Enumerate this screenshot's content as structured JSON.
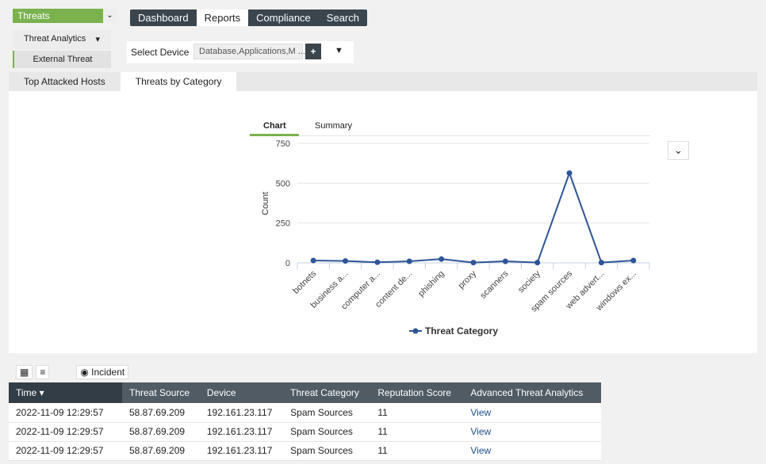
{
  "module": {
    "selected": "Threats"
  },
  "nav": [
    "Dashboard",
    "Reports",
    "Compliance",
    "Search"
  ],
  "sidebar": {
    "group": "Threat Analytics",
    "item": "External Threat"
  },
  "device_filter": {
    "label": "Select Device",
    "value": "Database,Applications,M ...",
    "add": "+"
  },
  "report_tabs": [
    "Top Attacked Hosts",
    "Threats by Category"
  ],
  "chart_tabs": [
    "Chart",
    "Summary"
  ],
  "chart_data": {
    "type": "line",
    "categories": [
      "botnets",
      "business a...",
      "computer a...",
      "content de...",
      "phishing",
      "proxy",
      "scanners",
      "society",
      "spam sources",
      "web advert...",
      "windows ex..."
    ],
    "series": [
      {
        "name": "Threat Category",
        "values": [
          15,
          12,
          4,
          10,
          24,
          2,
          10,
          2,
          563,
          2,
          15
        ]
      }
    ],
    "ylabel": "Count",
    "ylim": [
      0,
      750
    ],
    "yticks": [
      0,
      250,
      500,
      750
    ],
    "grid": true,
    "legend": "bottom",
    "color": "#2f5597"
  },
  "toolbar": {
    "incident": "Incident"
  },
  "table": {
    "columns": [
      "Time",
      "Threat Source",
      "Device",
      "Threat Category",
      "Reputation Score",
      "Advanced Threat Analytics"
    ],
    "rows": [
      [
        "2022-11-09 12:29:57",
        "58.87.69.209",
        "192.161.23.117",
        "Spam Sources",
        "11",
        "View"
      ],
      [
        "2022-11-09 12:29:57",
        "58.87.69.209",
        "192.161.23.117",
        "Spam Sources",
        "11",
        "View"
      ],
      [
        "2022-11-09 12:29:57",
        "58.87.69.209",
        "192.161.23.117",
        "Spam Sources",
        "11",
        "View"
      ]
    ]
  }
}
